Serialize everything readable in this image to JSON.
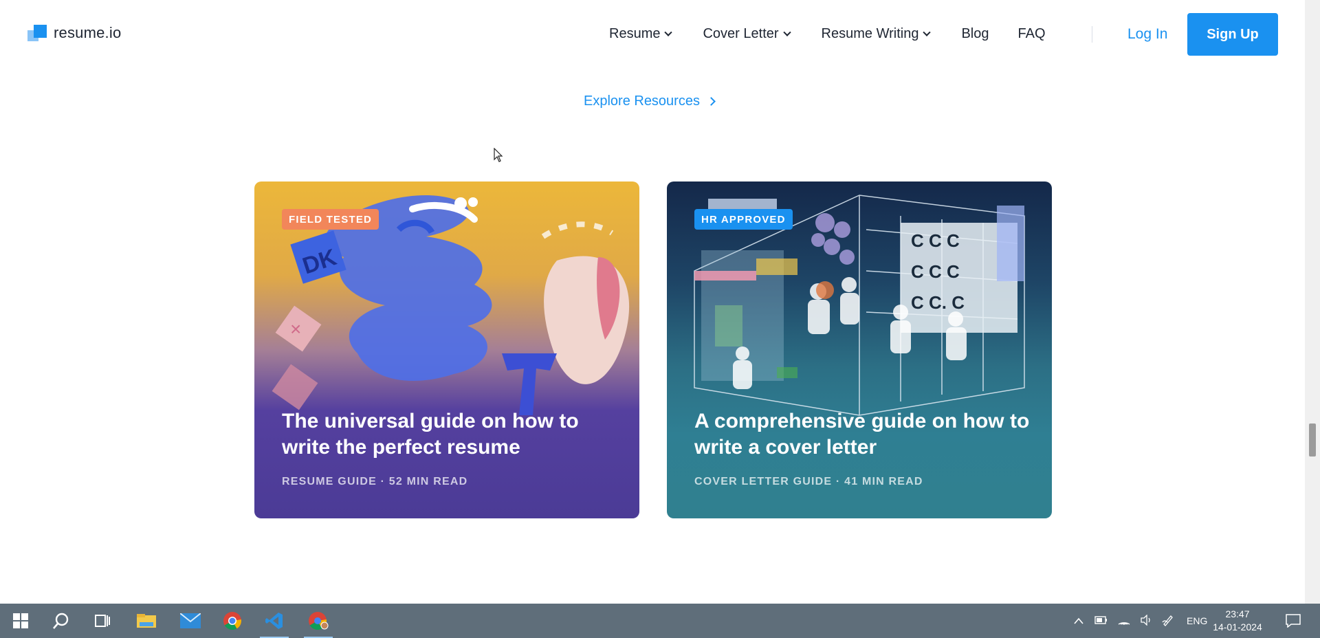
{
  "header": {
    "logo_text": "resume.io",
    "nav": [
      {
        "label": "Resume",
        "has_dropdown": true
      },
      {
        "label": "Cover Letter",
        "has_dropdown": true
      },
      {
        "label": "Resume Writing",
        "has_dropdown": true
      },
      {
        "label": "Blog",
        "has_dropdown": false
      },
      {
        "label": "FAQ",
        "has_dropdown": false
      }
    ],
    "login_label": "Log In",
    "signup_label": "Sign Up"
  },
  "explore_link": "Explore Resources",
  "cards": [
    {
      "badge": "FIELD TESTED",
      "title": "The universal guide on how to write the perfect resume",
      "meta": "RESUME GUIDE · 52 MIN READ",
      "badge_color": "#f2865a"
    },
    {
      "badge": "HR APPROVED",
      "title": "A comprehensive guide on how to write a cover letter",
      "meta": "COVER LETTER GUIDE · 41 MIN READ",
      "badge_color": "#1a91f0"
    }
  ],
  "taskbar": {
    "apps": [
      "windows-start-icon",
      "search-icon",
      "task-view-icon",
      "file-explorer-icon",
      "mail-icon",
      "chrome-icon",
      "vscode-icon",
      "chrome-profile-icon"
    ],
    "tray": {
      "language": "ENG",
      "time": "23:47",
      "date": "14-01-2024"
    }
  },
  "colors": {
    "accent": "#1a91f0",
    "text": "#1e2532",
    "taskbar": "#5f6e7a"
  }
}
